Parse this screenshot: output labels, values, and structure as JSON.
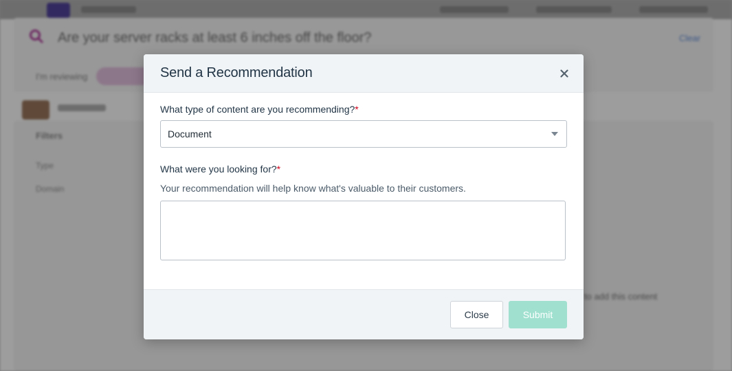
{
  "background": {
    "question": "Are your server racks at least 6 inches off the floor?",
    "clear_link": "Clear",
    "reviewing_label": "I'm reviewing",
    "filters_label": "Filters",
    "filter_items": [
      "Type",
      "Domain"
    ],
    "content_note": "to add this content"
  },
  "modal": {
    "title": "Send a Recommendation",
    "content_type_label": "What type of content are you recommending?",
    "required_mark": "*",
    "content_type_value": "Document",
    "looking_for_label": "What were you looking for?",
    "help_text": "Your recommendation will help know what's valuable to their customers.",
    "looking_for_value": "",
    "close_label": "Close",
    "submit_label": "Submit"
  },
  "colors": {
    "submit_disabled": "#9fe0cf",
    "required": "#d0021b",
    "title": "#1f3344"
  }
}
